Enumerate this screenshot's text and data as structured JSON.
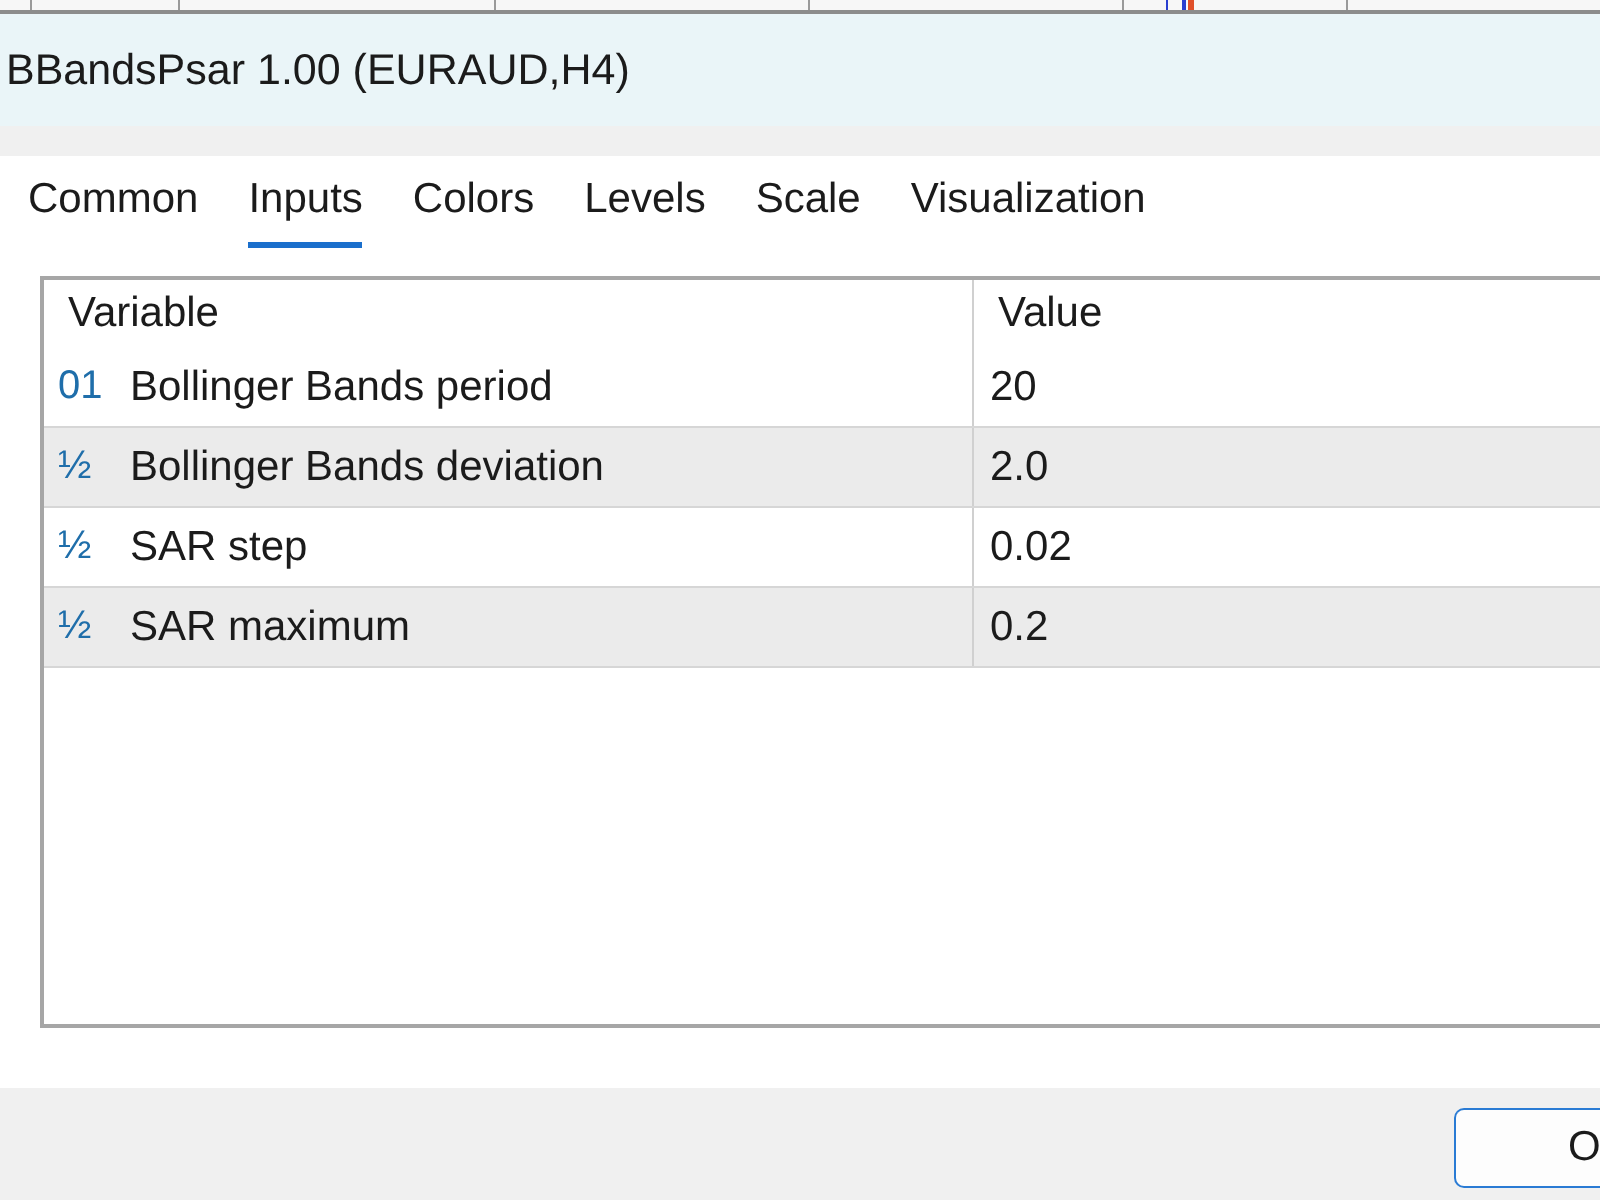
{
  "window": {
    "title": "BBandsPsar 1.00 (EURAUD,H4)"
  },
  "tabs": [
    {
      "label": "Common",
      "selected": false
    },
    {
      "label": "Inputs",
      "selected": true
    },
    {
      "label": "Colors",
      "selected": false
    },
    {
      "label": "Levels",
      "selected": false
    },
    {
      "label": "Scale",
      "selected": false
    },
    {
      "label": "Visualization",
      "selected": false
    }
  ],
  "table": {
    "columns": [
      "Variable",
      "Value"
    ],
    "rows": [
      {
        "type_glyph": "01",
        "variable": "Bollinger Bands period",
        "value": "20"
      },
      {
        "type_glyph": "½",
        "variable": "Bollinger Bands deviation",
        "value": "2.0"
      },
      {
        "type_glyph": "½",
        "variable": "SAR step",
        "value": "0.02"
      },
      {
        "type_glyph": "½",
        "variable": "SAR maximum",
        "value": "0.2"
      }
    ]
  },
  "buttons": [
    {
      "label": "O",
      "default": true
    }
  ]
}
